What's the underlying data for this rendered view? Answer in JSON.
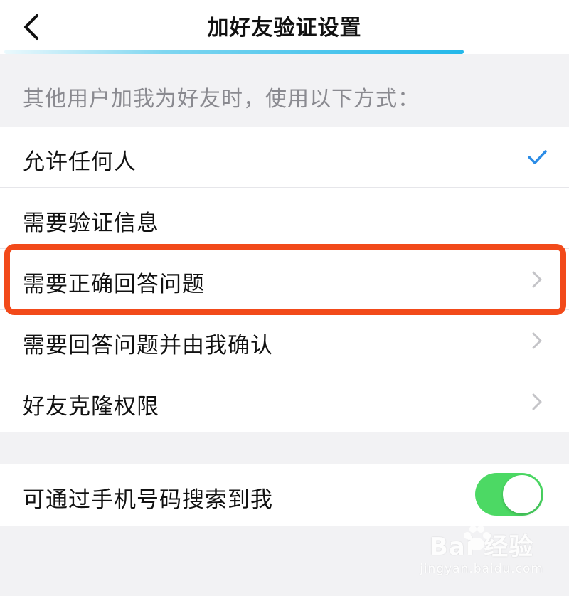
{
  "header": {
    "title": "加好友验证设置",
    "back_icon": "chevron-left-icon"
  },
  "section": {
    "caption": "其他用户加我为好友时，使用以下方式："
  },
  "options": [
    {
      "label": "允许任何人",
      "icon": "checkmark-icon",
      "selected": true
    },
    {
      "label": "需要验证信息",
      "icon": "",
      "selected": false
    },
    {
      "label": "需要正确回答问题",
      "icon": "chevron-right-icon",
      "selected": false
    },
    {
      "label": "需要回答问题并由我确认",
      "icon": "chevron-right-icon",
      "selected": false
    },
    {
      "label": "好友克隆权限",
      "icon": "chevron-right-icon",
      "selected": false
    }
  ],
  "phone_search": {
    "label": "可通过手机号码搜索到我",
    "enabled": true
  },
  "watermark": {
    "brand": "Bai 经验",
    "url": "jingyan.baidu.com"
  },
  "colors": {
    "accent_blue": "#2b8ce6",
    "toggle_on": "#4cd964",
    "highlight": "#f24a1a",
    "chevron": "#c4c4c8",
    "caption": "#8a8a90"
  }
}
